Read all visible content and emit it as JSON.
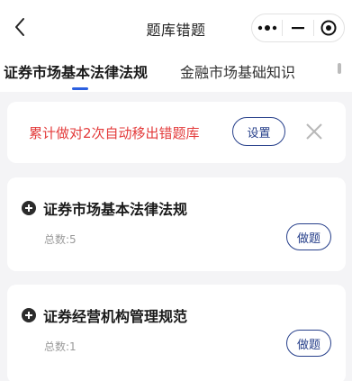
{
  "header": {
    "title": "题库错题",
    "back_icon": "chevron-left-icon",
    "menu_icons": [
      "more-dots-icon",
      "minimize-icon",
      "target-close-icon"
    ]
  },
  "tabs": [
    {
      "label": "证券市场基本法律法规",
      "active": true
    },
    {
      "label": "金融市场基础知识",
      "active": false
    }
  ],
  "notice": {
    "text": "累计做对2次自动移出错题库",
    "settings_label": "设置",
    "close_icon": "close-icon"
  },
  "cards": [
    {
      "title": "证券市场基本法律法规",
      "count": "总数:5",
      "action_label": "做题"
    },
    {
      "title": "证券经营机构管理规范",
      "count": "总数:1",
      "action_label": "做题"
    }
  ],
  "colors": {
    "accent": "#27408b",
    "tab_indicator": "#2b5fe0",
    "notice_text": "#e33a3a",
    "background": "#f4f4f6"
  }
}
